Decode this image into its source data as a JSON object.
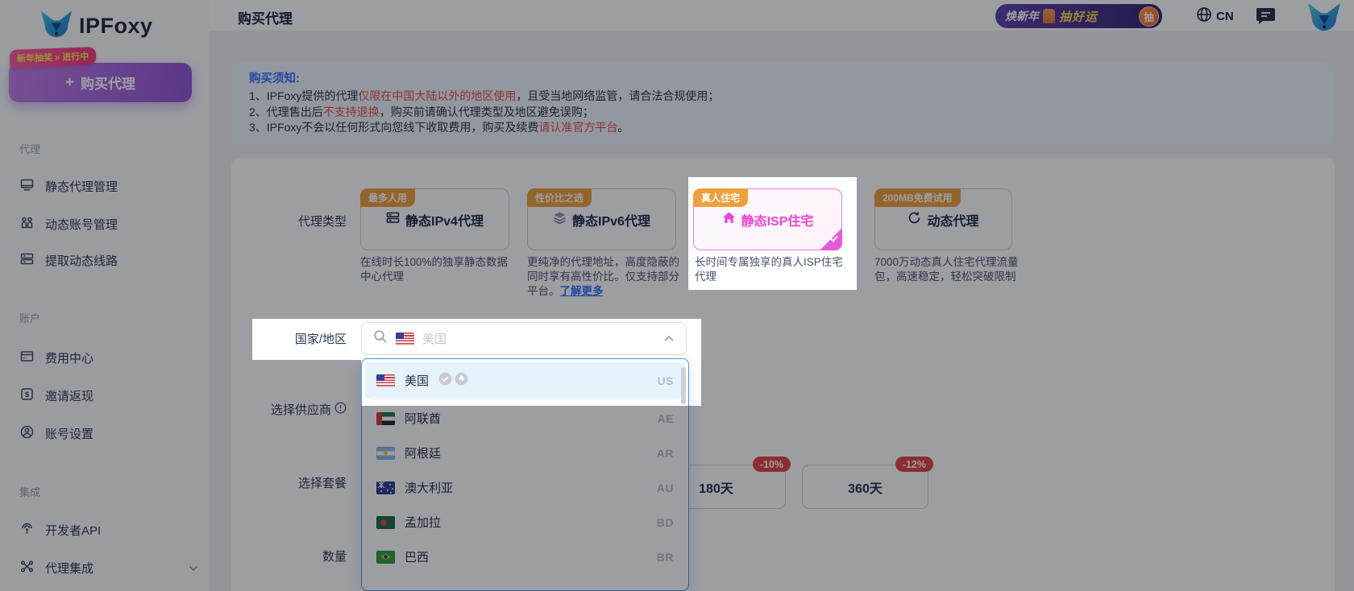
{
  "colors": {
    "accent_blue": "#3370ff",
    "warning_red": "#e34d4d",
    "badge_orange": "#efa03c",
    "selected_pink": "#f244d0",
    "discount_red": "#e04545",
    "dropdown_highlight": "#e6f3fd",
    "buy_button_purple": "#9254d6"
  },
  "sidebar": {
    "logo_text": "IPFoxy",
    "promo_badge": "新年抽奖 » 进行中",
    "buy_button": "购买代理",
    "buy_button_plus": "+",
    "sections": [
      {
        "label": "代理",
        "items": [
          {
            "label": "静态代理管理",
            "icon": "monitor-icon"
          },
          {
            "label": "动态账号管理",
            "icon": "users-icon"
          },
          {
            "label": "提取动态线路",
            "icon": "server-icon"
          }
        ]
      },
      {
        "label": "账户",
        "items": [
          {
            "label": "费用中心",
            "icon": "billing-card-icon"
          },
          {
            "label": "邀请返现",
            "icon": "dollar-icon"
          },
          {
            "label": "账号设置",
            "icon": "user-circle-icon"
          }
        ]
      },
      {
        "label": "集成",
        "items": [
          {
            "label": "开发者API",
            "icon": "api-signal-icon"
          },
          {
            "label": "代理集成",
            "icon": "integration-icon"
          }
        ]
      }
    ]
  },
  "header": {
    "title": "购买代理",
    "promo_banner": {
      "left": "焕新年",
      "right": "抽好运",
      "button": "抽"
    },
    "language": "CN"
  },
  "notice": {
    "title": "购买须知:",
    "lines": [
      {
        "pre": "1、IPFoxy提供的代理",
        "red": "仅限在中国大陆以外的地区使用",
        "post": "，且受当地网络监管，请合法合规使用；"
      },
      {
        "pre": "2、代理售出后",
        "red": "不支持退换",
        "post": "，购买前请确认代理类型及地区避免误购；"
      },
      {
        "pre": "3、IPFoxy不会以任何形式向您线下收取费用，购买及续费",
        "red": "请认准官方平台",
        "post": "。"
      }
    ]
  },
  "proxy_types": {
    "label": "代理类型",
    "cards": [
      {
        "badge": "最多人用",
        "title": "静态IPv4代理",
        "desc": "在线时长100%的独享静态数据中心代理",
        "icon": "server-icon",
        "selected": false
      },
      {
        "badge": "性价比之选",
        "title": "静态IPv6代理",
        "desc": "更纯净的代理地址，高度隐蔽的同时享有高性价比。仅支持部分平台。",
        "link": "了解更多",
        "icon": "layers-icon",
        "selected": false
      },
      {
        "badge": "真人住宅",
        "title": "静态ISP住宅",
        "desc": "长时间专属独享的真人ISP住宅代理",
        "icon": "home-icon",
        "selected": true
      },
      {
        "badge": "200MB免费试用",
        "title": "动态代理",
        "desc": "7000万动态真人住宅代理流量包，高速稳定，轻松突破限制",
        "icon": "refresh-icon",
        "selected": false
      }
    ]
  },
  "country_select": {
    "label": "国家/地区",
    "placeholder": "美国",
    "selected_flag": "flag-us-icon",
    "options": [
      {
        "name": "美国",
        "code": "US",
        "flag": "flag-us-icon",
        "highlighted": true,
        "badges": [
          "check-circle-icon",
          "hot-flame-icon"
        ]
      },
      {
        "name": "阿联酋",
        "code": "AE",
        "flag": "flag-ae-icon",
        "highlighted": false
      },
      {
        "name": "阿根廷",
        "code": "AR",
        "flag": "flag-ar-icon",
        "highlighted": false
      },
      {
        "name": "澳大利亚",
        "code": "AU",
        "flag": "flag-au-icon",
        "highlighted": false
      },
      {
        "name": "孟加拉",
        "code": "BD",
        "flag": "flag-bd-icon",
        "highlighted": false
      },
      {
        "name": "巴西",
        "code": "BR",
        "flag": "flag-br-icon",
        "highlighted": false
      }
    ]
  },
  "supplier": {
    "label": "选择供应商"
  },
  "packages": {
    "label": "选择套餐",
    "options": [
      {
        "name": "180天",
        "discount": "-10%"
      },
      {
        "name": "360天",
        "discount": "-12%"
      }
    ]
  },
  "quantity": {
    "label": "数量"
  }
}
